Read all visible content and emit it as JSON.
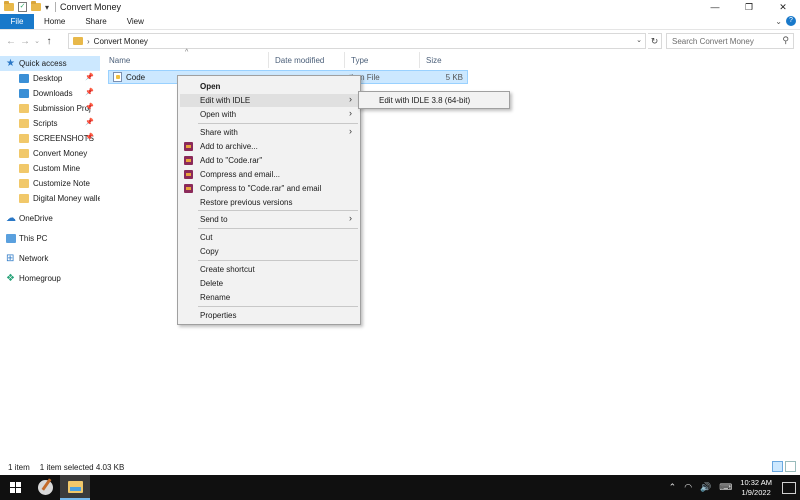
{
  "window": {
    "title": "Convert Money",
    "controls": {
      "minimize": "—",
      "maximize": "❐",
      "close": "✕"
    }
  },
  "ribbon": {
    "tabs": [
      "File",
      "Home",
      "Share",
      "View"
    ]
  },
  "address": {
    "path": "Convert Money",
    "search_placeholder": "Search Convert Money"
  },
  "sidebar": {
    "quick_access": "Quick access",
    "items": [
      {
        "label": "Desktop",
        "icon": "desktop-icon",
        "pinned": true
      },
      {
        "label": "Downloads",
        "icon": "download-icon",
        "pinned": true
      },
      {
        "label": "Submission Proj",
        "icon": "folder-icon",
        "pinned": true
      },
      {
        "label": "Scripts",
        "icon": "folder-icon",
        "pinned": true
      },
      {
        "label": "SCREENSHOTS",
        "icon": "folder-icon",
        "pinned": true
      },
      {
        "label": "Convert Money",
        "icon": "folder-icon",
        "pinned": false
      },
      {
        "label": "Custom Mine",
        "icon": "folder-icon",
        "pinned": false
      },
      {
        "label": "Customize Note",
        "icon": "folder-icon",
        "pinned": false
      },
      {
        "label": "Digital Money walle",
        "icon": "folder-icon",
        "pinned": false
      }
    ],
    "roots": {
      "onedrive": "OneDrive",
      "thispc": "This PC",
      "network": "Network",
      "homegroup": "Homegroup"
    }
  },
  "columns": {
    "name": "Name",
    "date": "Date modified",
    "type": "Type",
    "size": "Size"
  },
  "files": [
    {
      "name": "Code",
      "type": "thon File",
      "size": "5 KB"
    }
  ],
  "context_menu": {
    "open": "Open",
    "edit_idle": "Edit with IDLE",
    "open_with": "Open with",
    "share_with": "Share with",
    "add_archive": "Add to archive...",
    "add_rar": "Add to \"Code.rar\"",
    "compress_email": "Compress and email...",
    "compress_rar_email": "Compress to \"Code.rar\" and email",
    "restore": "Restore previous versions",
    "send_to": "Send to",
    "cut": "Cut",
    "copy": "Copy",
    "create_shortcut": "Create shortcut",
    "delete": "Delete",
    "rename": "Rename",
    "properties": "Properties"
  },
  "submenu": {
    "item": "Edit with IDLE 3.8 (64-bit)"
  },
  "status": {
    "count": "1 item",
    "selected": "1 item selected  4.03 KB"
  },
  "taskbar": {
    "time": "10:32 AM",
    "date": "1/9/2022"
  },
  "colors": {
    "accent": "#1979ca",
    "selection": "#cce8ff",
    "taskbar": "#101010"
  }
}
